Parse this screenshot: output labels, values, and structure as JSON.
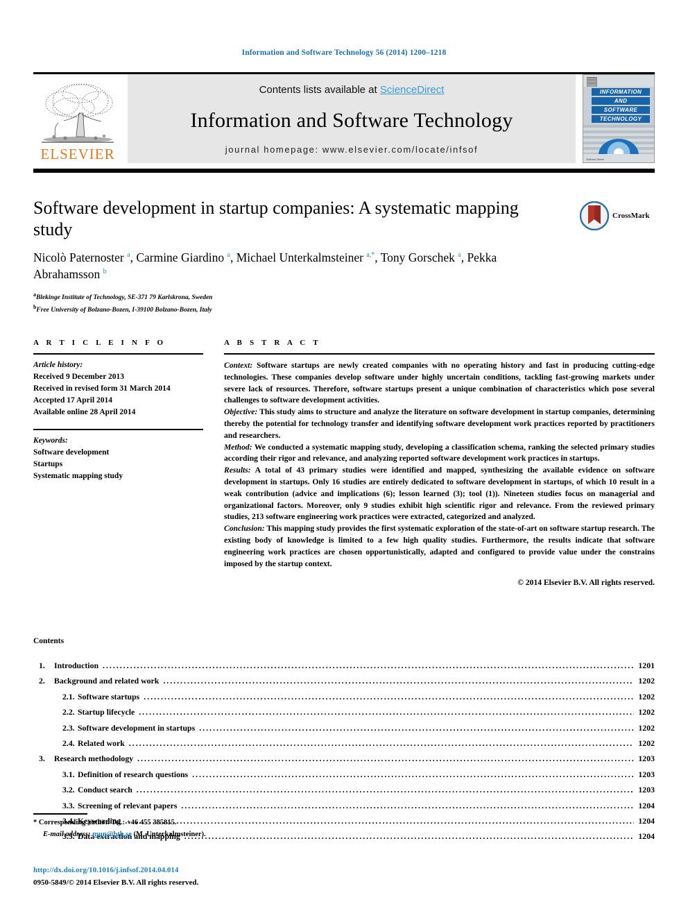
{
  "running_head": "Information and Software Technology 56 (2014) 1200–1218",
  "masthead": {
    "publisher_name": "ELSEVIER",
    "publisher_logo_alt": "elsevier-tree-logo",
    "contents_prefix": "Contents lists available at ",
    "contents_link": "ScienceDirect",
    "journal_title": "Information and Software Technology",
    "homepage_line": "journal homepage: www.elsevier.com/locate/infsof",
    "cover": {
      "line1": "INFORMATION",
      "line2": "AND",
      "line3": "SOFTWARE",
      "line4": "TECHNOLOGY",
      "footer": "Science Direct"
    }
  },
  "article": {
    "title": "Software development in startup companies: A systematic mapping study",
    "crossmark_label": "CrossMark",
    "authors_html": "Nicolò Paternoster <sup>a</sup>, Carmine Giardino <sup>a</sup>, Michael Unterkalmsteiner <sup>a,*</sup>, Tony Gorschek <sup>a</sup>, Pekka Abrahamsson <sup>b</sup>",
    "affiliations": [
      {
        "marker": "a",
        "text": "Blekinge Institute of Technology, SE-371 79 Karlskrona, Sweden"
      },
      {
        "marker": "b",
        "text": "Free University of Bolzano-Bozen, I-39100 Bolzano-Bozen, Italy"
      }
    ]
  },
  "article_info": {
    "heading": "A R T I C L E   I N F O",
    "history_label": "Article history:",
    "history": [
      "Received 9 December 2013",
      "Received in revised form 31 March 2014",
      "Accepted 17 April 2014",
      "Available online 28 April 2014"
    ],
    "keywords_label": "Keywords:",
    "keywords": [
      "Software development",
      "Startups",
      "Systematic mapping study"
    ]
  },
  "abstract": {
    "heading": "A B S T R A C T",
    "sections": [
      {
        "lead": "Context:",
        "text": " Software startups are newly created companies with no operating history and fast in producing cutting-edge technologies. These companies develop software under highly uncertain conditions, tackling fast-growing markets under severe lack of resources. Therefore, software startups present a unique combination of characteristics which pose several challenges to software development activities."
      },
      {
        "lead": "Objective:",
        "text": " This study aims to structure and analyze the literature on software development in startup companies, determining thereby the potential for technology transfer and identifying software development work practices reported by practitioners and researchers."
      },
      {
        "lead": "Method:",
        "text": " We conducted a systematic mapping study, developing a classification schema, ranking the selected primary studies according their rigor and relevance, and analyzing reported software development work practices in startups."
      },
      {
        "lead": "Results:",
        "text": " A total of 43 primary studies were identified and mapped, synthesizing the available evidence on software development in startups. Only 16 studies are entirely dedicated to software development in startups, of which 10 result in a weak contribution (advice and implications (6); lesson learned (3); tool (1)). Nineteen studies focus on managerial and organizational factors. Moreover, only 9 studies exhibit high scientific rigor and relevance. From the reviewed primary studies, 213 software engineering work practices were extracted, categorized and analyzed."
      },
      {
        "lead": "Conclusion:",
        "text": " This mapping study provides the first systematic exploration of the state-of-art on software startup research. The existing body of knowledge is limited to a few high quality studies. Furthermore, the results indicate that software engineering work practices are chosen opportunistically, adapted and configured to provide value under the constrains imposed by the startup context."
      }
    ],
    "copyright": "© 2014 Elsevier B.V. All rights reserved."
  },
  "contents": {
    "heading": "Contents",
    "entries": [
      {
        "level": 1,
        "num": "1.",
        "label": "Introduction",
        "page": "1201"
      },
      {
        "level": 1,
        "num": "2.",
        "label": "Background and related work",
        "page": "1202"
      },
      {
        "level": 2,
        "num": "2.1.",
        "label": "Software startups",
        "page": "1202"
      },
      {
        "level": 2,
        "num": "2.2.",
        "label": "Startup lifecycle",
        "page": "1202"
      },
      {
        "level": 2,
        "num": "2.3.",
        "label": "Software development in startups",
        "page": "1202"
      },
      {
        "level": 2,
        "num": "2.4.",
        "label": "Related work",
        "page": "1202"
      },
      {
        "level": 1,
        "num": "3.",
        "label": "Research methodology",
        "page": "1203"
      },
      {
        "level": 2,
        "num": "3.1.",
        "label": "Definition of research questions",
        "page": "1203"
      },
      {
        "level": 2,
        "num": "3.2.",
        "label": "Conduct search",
        "page": "1203"
      },
      {
        "level": 2,
        "num": "3.3.",
        "label": "Screening of relevant papers",
        "page": "1204"
      },
      {
        "level": 2,
        "num": "3.4.",
        "label": "Keywording",
        "page": "1204"
      },
      {
        "level": 2,
        "num": "3.5.",
        "label": "Data extraction and mapping",
        "page": "1204"
      }
    ]
  },
  "footnotes": {
    "corresponding_marker": "*",
    "corresponding_text": "Corresponding author. Tel.: +46 455 385815.",
    "email_label": "E-mail address:",
    "email": "mun@bth.se",
    "email_owner": "(M. Unterkalmsteiner)."
  },
  "footer": {
    "doi": "http://dx.doi.org/10.1016/j.infsof.2014.04.014",
    "issn_copyright": "0950-5849/© 2014 Elsevier B.V. All rights reserved."
  },
  "colors": {
    "link_blue": "#1f7fba",
    "sciencedirect_blue": "#3c9ad6",
    "elsevier_orange": "#E87722",
    "cover_blue": "#1964a8"
  }
}
